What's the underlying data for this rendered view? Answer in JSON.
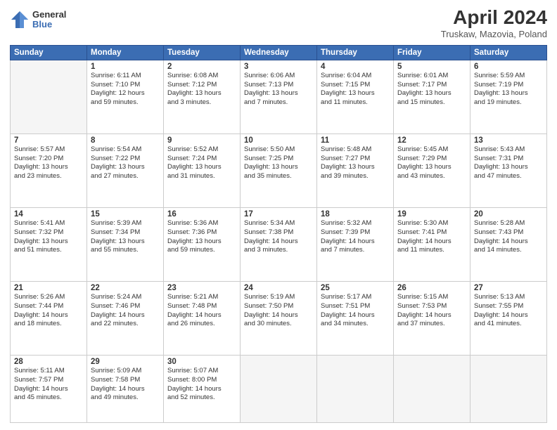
{
  "logo": {
    "general": "General",
    "blue": "Blue"
  },
  "title": {
    "month_year": "April 2024",
    "location": "Truskaw, Mazovia, Poland"
  },
  "days_of_week": [
    "Sunday",
    "Monday",
    "Tuesday",
    "Wednesday",
    "Thursday",
    "Friday",
    "Saturday"
  ],
  "weeks": [
    [
      {
        "day": "",
        "empty": true
      },
      {
        "day": "1",
        "sunrise": "Sunrise: 6:11 AM",
        "sunset": "Sunset: 7:10 PM",
        "daylight": "Daylight: 12 hours and 59 minutes."
      },
      {
        "day": "2",
        "sunrise": "Sunrise: 6:08 AM",
        "sunset": "Sunset: 7:12 PM",
        "daylight": "Daylight: 13 hours and 3 minutes."
      },
      {
        "day": "3",
        "sunrise": "Sunrise: 6:06 AM",
        "sunset": "Sunset: 7:13 PM",
        "daylight": "Daylight: 13 hours and 7 minutes."
      },
      {
        "day": "4",
        "sunrise": "Sunrise: 6:04 AM",
        "sunset": "Sunset: 7:15 PM",
        "daylight": "Daylight: 13 hours and 11 minutes."
      },
      {
        "day": "5",
        "sunrise": "Sunrise: 6:01 AM",
        "sunset": "Sunset: 7:17 PM",
        "daylight": "Daylight: 13 hours and 15 minutes."
      },
      {
        "day": "6",
        "sunrise": "Sunrise: 5:59 AM",
        "sunset": "Sunset: 7:19 PM",
        "daylight": "Daylight: 13 hours and 19 minutes."
      }
    ],
    [
      {
        "day": "7",
        "sunrise": "Sunrise: 5:57 AM",
        "sunset": "Sunset: 7:20 PM",
        "daylight": "Daylight: 13 hours and 23 minutes."
      },
      {
        "day": "8",
        "sunrise": "Sunrise: 5:54 AM",
        "sunset": "Sunset: 7:22 PM",
        "daylight": "Daylight: 13 hours and 27 minutes."
      },
      {
        "day": "9",
        "sunrise": "Sunrise: 5:52 AM",
        "sunset": "Sunset: 7:24 PM",
        "daylight": "Daylight: 13 hours and 31 minutes."
      },
      {
        "day": "10",
        "sunrise": "Sunrise: 5:50 AM",
        "sunset": "Sunset: 7:25 PM",
        "daylight": "Daylight: 13 hours and 35 minutes."
      },
      {
        "day": "11",
        "sunrise": "Sunrise: 5:48 AM",
        "sunset": "Sunset: 7:27 PM",
        "daylight": "Daylight: 13 hours and 39 minutes."
      },
      {
        "day": "12",
        "sunrise": "Sunrise: 5:45 AM",
        "sunset": "Sunset: 7:29 PM",
        "daylight": "Daylight: 13 hours and 43 minutes."
      },
      {
        "day": "13",
        "sunrise": "Sunrise: 5:43 AM",
        "sunset": "Sunset: 7:31 PM",
        "daylight": "Daylight: 13 hours and 47 minutes."
      }
    ],
    [
      {
        "day": "14",
        "sunrise": "Sunrise: 5:41 AM",
        "sunset": "Sunset: 7:32 PM",
        "daylight": "Daylight: 13 hours and 51 minutes."
      },
      {
        "day": "15",
        "sunrise": "Sunrise: 5:39 AM",
        "sunset": "Sunset: 7:34 PM",
        "daylight": "Daylight: 13 hours and 55 minutes."
      },
      {
        "day": "16",
        "sunrise": "Sunrise: 5:36 AM",
        "sunset": "Sunset: 7:36 PM",
        "daylight": "Daylight: 13 hours and 59 minutes."
      },
      {
        "day": "17",
        "sunrise": "Sunrise: 5:34 AM",
        "sunset": "Sunset: 7:38 PM",
        "daylight": "Daylight: 14 hours and 3 minutes."
      },
      {
        "day": "18",
        "sunrise": "Sunrise: 5:32 AM",
        "sunset": "Sunset: 7:39 PM",
        "daylight": "Daylight: 14 hours and 7 minutes."
      },
      {
        "day": "19",
        "sunrise": "Sunrise: 5:30 AM",
        "sunset": "Sunset: 7:41 PM",
        "daylight": "Daylight: 14 hours and 11 minutes."
      },
      {
        "day": "20",
        "sunrise": "Sunrise: 5:28 AM",
        "sunset": "Sunset: 7:43 PM",
        "daylight": "Daylight: 14 hours and 14 minutes."
      }
    ],
    [
      {
        "day": "21",
        "sunrise": "Sunrise: 5:26 AM",
        "sunset": "Sunset: 7:44 PM",
        "daylight": "Daylight: 14 hours and 18 minutes."
      },
      {
        "day": "22",
        "sunrise": "Sunrise: 5:24 AM",
        "sunset": "Sunset: 7:46 PM",
        "daylight": "Daylight: 14 hours and 22 minutes."
      },
      {
        "day": "23",
        "sunrise": "Sunrise: 5:21 AM",
        "sunset": "Sunset: 7:48 PM",
        "daylight": "Daylight: 14 hours and 26 minutes."
      },
      {
        "day": "24",
        "sunrise": "Sunrise: 5:19 AM",
        "sunset": "Sunset: 7:50 PM",
        "daylight": "Daylight: 14 hours and 30 minutes."
      },
      {
        "day": "25",
        "sunrise": "Sunrise: 5:17 AM",
        "sunset": "Sunset: 7:51 PM",
        "daylight": "Daylight: 14 hours and 34 minutes."
      },
      {
        "day": "26",
        "sunrise": "Sunrise: 5:15 AM",
        "sunset": "Sunset: 7:53 PM",
        "daylight": "Daylight: 14 hours and 37 minutes."
      },
      {
        "day": "27",
        "sunrise": "Sunrise: 5:13 AM",
        "sunset": "Sunset: 7:55 PM",
        "daylight": "Daylight: 14 hours and 41 minutes."
      }
    ],
    [
      {
        "day": "28",
        "sunrise": "Sunrise: 5:11 AM",
        "sunset": "Sunset: 7:57 PM",
        "daylight": "Daylight: 14 hours and 45 minutes."
      },
      {
        "day": "29",
        "sunrise": "Sunrise: 5:09 AM",
        "sunset": "Sunset: 7:58 PM",
        "daylight": "Daylight: 14 hours and 49 minutes."
      },
      {
        "day": "30",
        "sunrise": "Sunrise: 5:07 AM",
        "sunset": "Sunset: 8:00 PM",
        "daylight": "Daylight: 14 hours and 52 minutes."
      },
      {
        "day": "",
        "empty": true
      },
      {
        "day": "",
        "empty": true
      },
      {
        "day": "",
        "empty": true
      },
      {
        "day": "",
        "empty": true
      }
    ]
  ]
}
